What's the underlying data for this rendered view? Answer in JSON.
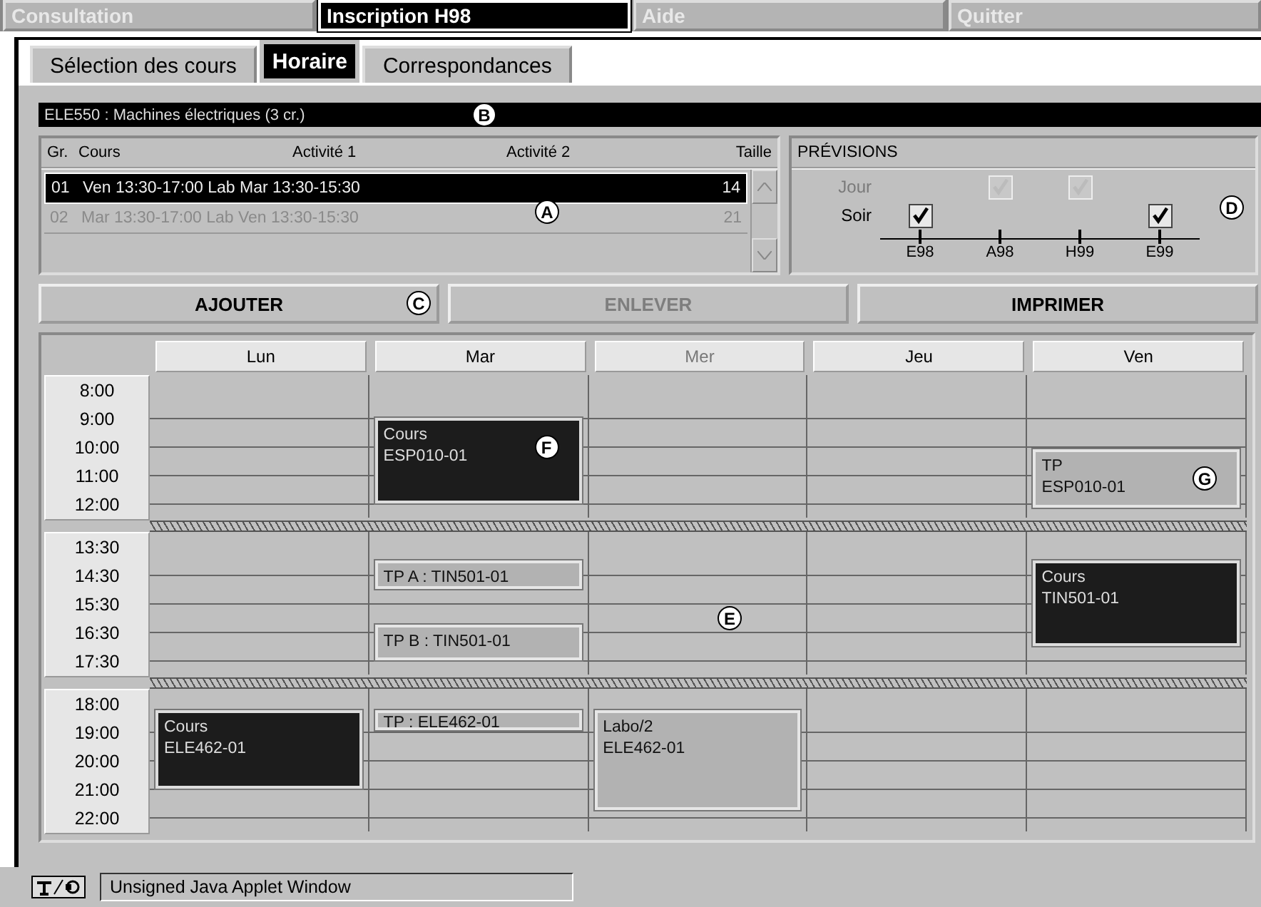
{
  "menu": [
    {
      "label": "Consultation",
      "selected": false,
      "disabled": true
    },
    {
      "label": "Inscription H98",
      "selected": true,
      "disabled": false
    },
    {
      "label": "Aide",
      "selected": false,
      "disabled": true
    },
    {
      "label": "Quitter",
      "selected": false,
      "disabled": true
    }
  ],
  "tabs": [
    {
      "label": "Sélection des cours",
      "selected": false
    },
    {
      "label": "Horaire",
      "selected": true
    },
    {
      "label": "Correspondances",
      "selected": false
    }
  ],
  "course_header": {
    "title": "ELE550 : Machines électriques (3 cr.)",
    "callout": "B"
  },
  "groups_table": {
    "columns": [
      "Gr.",
      "Cours",
      "Activité 1",
      "Activité 2",
      "Taille"
    ],
    "callout": "A",
    "rows": [
      {
        "group": "01",
        "schedule": "Ven 13:30-17:00 Lab Mar 13:30-15:30",
        "size": "14",
        "selected": true,
        "disabled": false
      },
      {
        "group": "02",
        "schedule": "Mar 13:30-17:00 Lab Ven 13:30-15:30",
        "size": "21",
        "selected": false,
        "disabled": true
      }
    ]
  },
  "previsions": {
    "title": "PRÉVISIONS",
    "callout": "D",
    "terms": [
      "E98",
      "A98",
      "H99",
      "E99"
    ],
    "rows": [
      {
        "label": "Jour",
        "disabled": true,
        "cells": [
          {
            "kind": "none"
          },
          {
            "kind": "checkbox",
            "checked": true
          },
          {
            "kind": "checkbox",
            "checked": true
          },
          {
            "kind": "none"
          }
        ]
      },
      {
        "label": "Soir",
        "disabled": false,
        "cells": [
          {
            "kind": "checkbox",
            "checked": true
          },
          {
            "kind": "none"
          },
          {
            "kind": "none"
          },
          {
            "kind": "checkbox",
            "checked": true
          }
        ]
      }
    ]
  },
  "actions": [
    {
      "label": "AJOUTER",
      "disabled": false,
      "callout": "C"
    },
    {
      "label": "ENLEVER",
      "disabled": true
    },
    {
      "label": "IMPRIMER",
      "disabled": false
    }
  ],
  "schedule": {
    "callout": "E",
    "sections": [
      {
        "times": [
          "8:00",
          "9:00",
          "10:00",
          "11:00",
          "12:00"
        ]
      },
      {
        "times": [
          "13:30",
          "14:30",
          "15:30",
          "16:30",
          "17:30"
        ]
      },
      {
        "times": [
          "18:00",
          "19:00",
          "20:00",
          "21:00",
          "22:00"
        ]
      }
    ],
    "days": [
      {
        "label": "Lun",
        "disabled": false,
        "events": [
          {
            "kind": "course",
            "lines": [
              "Cours",
              "ELE462-01"
            ]
          }
        ]
      },
      {
        "label": "Mar",
        "disabled": false,
        "events": [
          {
            "kind": "course",
            "lines": [
              "Cours",
              "ESP010-01"
            ],
            "callout": "F"
          },
          {
            "kind": "lab",
            "lines": [
              "TP A : TIN501-01"
            ]
          },
          {
            "kind": "lab",
            "lines": [
              "TP B : TIN501-01"
            ]
          },
          {
            "kind": "lab",
            "lines": [
              "TP : ELE462-01"
            ]
          }
        ]
      },
      {
        "label": "Mer",
        "disabled": true,
        "events": [
          {
            "kind": "lab",
            "lines": [
              "Labo/2",
              "ELE462-01"
            ]
          }
        ]
      },
      {
        "label": "Jeu",
        "disabled": false
      },
      {
        "label": "Ven",
        "disabled": false,
        "events": [
          {
            "kind": "lab",
            "lines": [
              "TP",
              "ESP010-01"
            ],
            "callout": "G"
          },
          {
            "kind": "course",
            "lines": [
              "Cours",
              "TIN501-01"
            ]
          }
        ]
      }
    ]
  },
  "status_bar": {
    "text": "Unsigned Java Applet Window"
  }
}
